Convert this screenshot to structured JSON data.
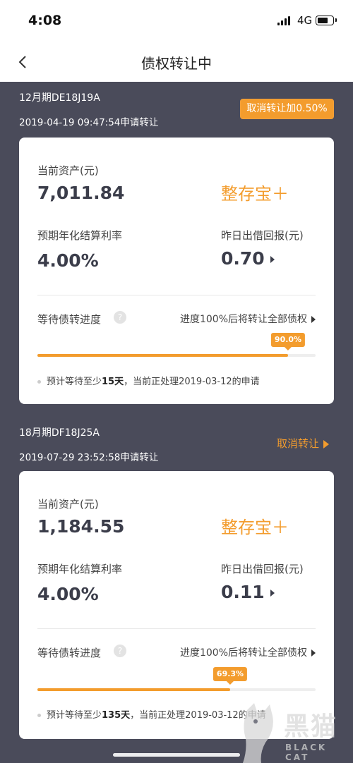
{
  "status": {
    "time": "4:08",
    "network": "4G"
  },
  "nav": {
    "title": "债权转让中"
  },
  "items": [
    {
      "period": "12月期DE18J19A",
      "apply": "2019-04-19 09:47:54申请转让",
      "cancel": "取消转让加0.50%",
      "asset_label": "当前资产(元)",
      "asset_value": "7,011.84",
      "product": "整存宝＋",
      "rate_label": "预期年化结算利率",
      "rate_value": "4.00%",
      "return_label": "昨日出借回报(元)",
      "return_value": "0.70",
      "progress_label": "等待债转进度",
      "progress_rule": "进度100%后将转让全部债权",
      "progress": 0.9,
      "progress_text": "90.0%",
      "note_a": "预计等待至少",
      "note_days": "15天",
      "note_b": "，当前正处理2019-03-12的申请"
    },
    {
      "period": "18月期DF18J25A",
      "apply": "2019-07-29 23:52:58申请转让",
      "cancel": "取消转让",
      "asset_label": "当前资产(元)",
      "asset_value": "1,184.55",
      "product": "整存宝＋",
      "rate_label": "预期年化结算利率",
      "rate_value": "4.00%",
      "return_label": "昨日出借回报(元)",
      "return_value": "0.11",
      "progress_label": "等待债转进度",
      "progress_rule": "进度100%后将转让全部债权",
      "progress": 0.693,
      "progress_text": "69.3%",
      "note_a": "预计等待至少",
      "note_days": "135天",
      "note_b": "，当前正处理2019-03-12的申请"
    }
  ],
  "watermark": {
    "text": "黑猫",
    "sub": "BLACK CAT"
  },
  "colors": {
    "accent": "#f39c2d",
    "background": "#4a4b5a"
  }
}
